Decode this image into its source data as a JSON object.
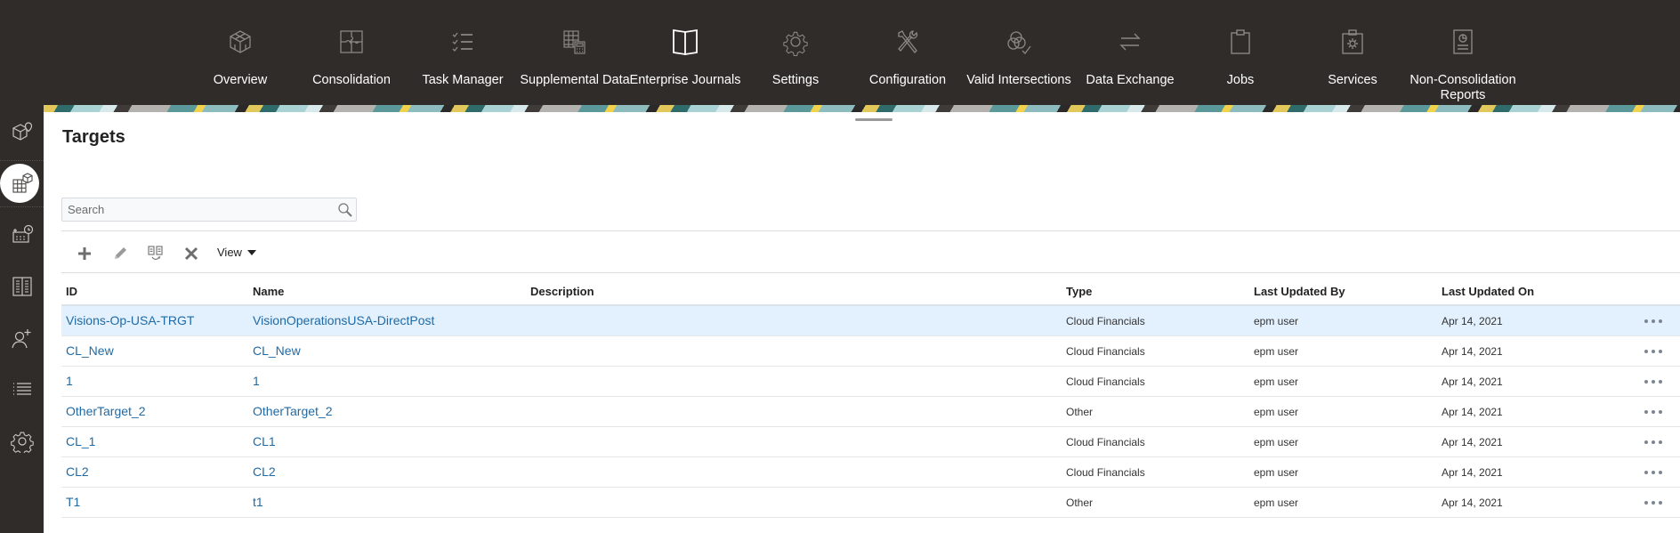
{
  "topnav": {
    "items": [
      {
        "label": "Overview",
        "icon": "cube-icon"
      },
      {
        "label": "Consolidation",
        "icon": "puzzle-icon"
      },
      {
        "label": "Task Manager",
        "icon": "checklist-icon"
      },
      {
        "label": "Supplemental Data",
        "icon": "grid-calculator-icon"
      },
      {
        "label": "Enterprise Journals",
        "icon": "open-book-icon"
      },
      {
        "label": "Settings",
        "icon": "gear-icon"
      },
      {
        "label": "Configuration",
        "icon": "tools-icon"
      },
      {
        "label": "Valid Intersections",
        "icon": "venn-check-icon"
      },
      {
        "label": "Data Exchange",
        "icon": "arrows-exchange-icon"
      },
      {
        "label": "Jobs",
        "icon": "clipboard-icon"
      },
      {
        "label": "Services",
        "icon": "service-bag-icon"
      },
      {
        "label": "Non-Consolidation",
        "label2": "Reports",
        "icon": "report-icon"
      }
    ]
  },
  "sidebar": {
    "items": [
      {
        "name": "cube-pin-icon"
      },
      {
        "name": "grid-cube-icon",
        "active": true
      },
      {
        "name": "calendar-clock-icon"
      },
      {
        "name": "columns-book-icon"
      },
      {
        "name": "add-user-icon"
      },
      {
        "name": "list-icon"
      },
      {
        "name": "gear-icon"
      }
    ]
  },
  "page": {
    "title": "Targets"
  },
  "search": {
    "placeholder": "Search",
    "value": ""
  },
  "toolbar": {
    "add_icon": "plus-icon",
    "edit_icon": "pencil-icon",
    "duplicate_icon": "duplicate-icon",
    "delete_icon": "delete-x-icon",
    "view_label": "View"
  },
  "table": {
    "columns": [
      "ID",
      "Name",
      "Description",
      "Type",
      "Last Updated By",
      "Last Updated On"
    ],
    "rows": [
      {
        "id": "Visions-Op-USA-TRGT",
        "name": "VisionOperationsUSA-DirectPost",
        "description": "",
        "type": "Cloud Financials",
        "updated_by": "epm user",
        "updated_on": "Apr 14, 2021",
        "selected": true
      },
      {
        "id": "CL_New",
        "name": "CL_New",
        "description": "",
        "type": "Cloud Financials",
        "updated_by": "epm user",
        "updated_on": "Apr 14, 2021"
      },
      {
        "id": "1",
        "name": "1",
        "description": "",
        "type": "Cloud Financials",
        "updated_by": "epm user",
        "updated_on": "Apr 14, 2021"
      },
      {
        "id": "OtherTarget_2",
        "name": "OtherTarget_2",
        "description": "",
        "type": "Other",
        "updated_by": "epm user",
        "updated_on": "Apr 14, 2021"
      },
      {
        "id": "CL_1",
        "name": "CL1",
        "description": "",
        "type": "Cloud Financials",
        "updated_by": "epm user",
        "updated_on": "Apr 14, 2021"
      },
      {
        "id": "CL2",
        "name": "CL2",
        "description": "",
        "type": "Cloud Financials",
        "updated_by": "epm user",
        "updated_on": "Apr 14, 2021"
      },
      {
        "id": "T1",
        "name": "t1",
        "description": "",
        "type": "Other",
        "updated_by": "epm user",
        "updated_on": "Apr 14, 2021"
      }
    ]
  },
  "colors": {
    "nav_bg": "#2f2c29",
    "link": "#1f6aa5",
    "selected_row": "#e3f0fd"
  }
}
